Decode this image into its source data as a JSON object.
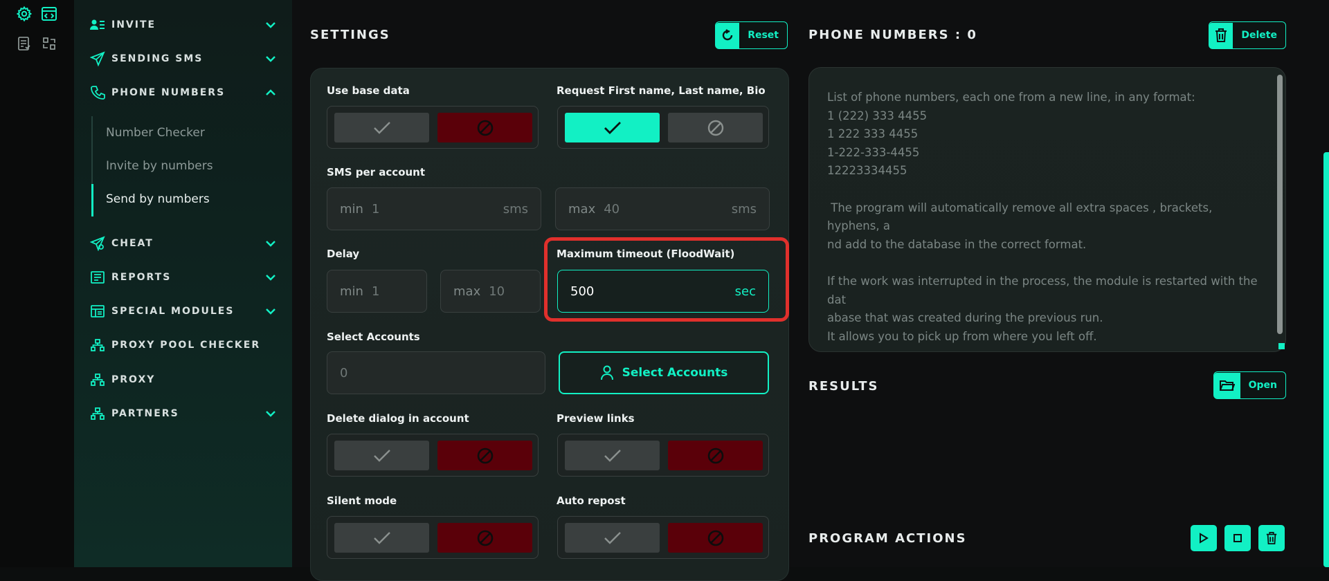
{
  "sidebar": {
    "items": [
      {
        "label": "INVITE",
        "icon": "user-list-icon"
      },
      {
        "label": "SENDING SMS",
        "icon": "send-icon"
      },
      {
        "label": "PHONE NUMBERS",
        "icon": "phone-icon"
      },
      {
        "label": "CHEAT",
        "icon": "send-icon"
      },
      {
        "label": "REPORTS",
        "icon": "reports-icon"
      },
      {
        "label": "SPECIAL MODULES",
        "icon": "modules-icon"
      },
      {
        "label": "PROXY POOL CHECKER",
        "icon": "network-icon"
      },
      {
        "label": "PROXY",
        "icon": "network-icon"
      },
      {
        "label": "PARTNERS",
        "icon": "network-icon"
      }
    ],
    "sub_items": [
      "Number Checker",
      "Invite by numbers",
      "Send by numbers"
    ]
  },
  "settings": {
    "title": "SETTINGS",
    "reset_label": "Reset",
    "use_base_data": "Use base data",
    "request_names": "Request First name, Last name, Bio",
    "sms_per_account": "SMS per account",
    "sms_min_prefix": "min",
    "sms_min_value": "1",
    "sms_min_suffix": "sms",
    "sms_max_prefix": "max",
    "sms_max_value": "40",
    "sms_max_suffix": "sms",
    "delay": "Delay",
    "delay_min_prefix": "min",
    "delay_min_value": "1",
    "delay_max_prefix": "max",
    "delay_max_value": "10",
    "max_timeout": "Maximum timeout (FloodWait)",
    "timeout_value": "500",
    "timeout_suffix": "sec",
    "select_accounts": "Select Accounts",
    "accounts_value": "0",
    "select_accounts_button": "Select Accounts",
    "delete_dialog": "Delete dialog in account",
    "preview_links": "Preview links",
    "silent_mode": "Silent mode",
    "auto_repost": "Auto repost"
  },
  "phone_numbers": {
    "title": "PHONE NUMBERS : 0",
    "delete_label": "Delete",
    "placeholder": "List of phone numbers, each one from a new line, in any format:\n1 (222) 333 4455\n1 222 333 4455\n1-222-333-4455\n12223334455\n\n The program will automatically remove all extra spaces , brackets, hyphens, a\nnd add to the database in the correct format.\n\nIf the work was interrupted in the process, the module is restarted with the dat\nabase that was created during the previous run.\nIt allows you to pick up from where you left off.\n\nSee the video on the main page for more details."
  },
  "results": {
    "title": "RESULTS",
    "open_label": "Open"
  },
  "program_actions": {
    "title": "PROGRAM ACTIONS"
  },
  "colors": {
    "accent": "#12f0c4",
    "danger": "#5a0009",
    "highlight": "#e0302c"
  }
}
